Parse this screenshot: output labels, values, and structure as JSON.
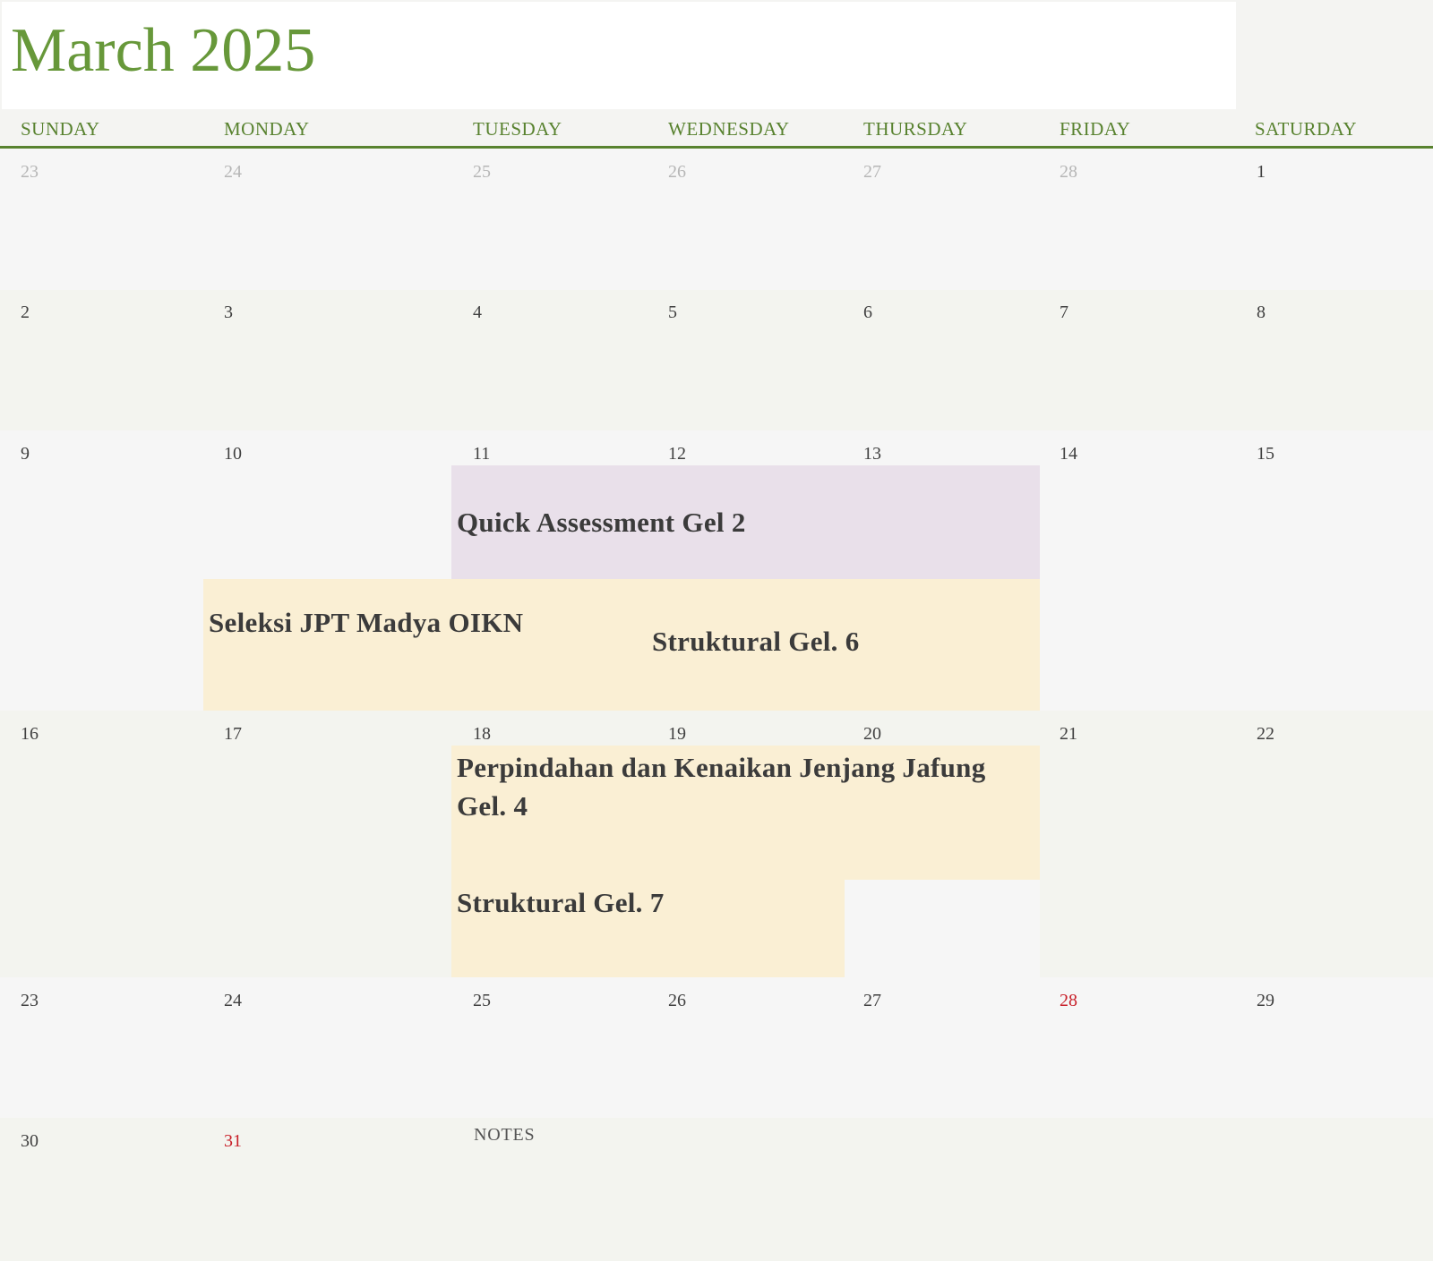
{
  "title": "March 2025",
  "day_names": [
    "SUNDAY",
    "MONDAY",
    "TUESDAY",
    "WEDNESDAY",
    "THURSDAY",
    "FRIDAY",
    "SATURDAY"
  ],
  "weeks": [
    [
      "23",
      "24",
      "25",
      "26",
      "27",
      "28",
      "1"
    ],
    [
      "2",
      "3",
      "4",
      "5",
      "6",
      "7",
      "8"
    ],
    [
      "9",
      "10",
      "11",
      "12",
      "13",
      "14",
      "15"
    ],
    [
      "16",
      "17",
      "18",
      "19",
      "20",
      "21",
      "22"
    ],
    [
      "23",
      "24",
      "25",
      "26",
      "27",
      "28",
      "29"
    ],
    [
      "30",
      "31"
    ]
  ],
  "events": {
    "quick_assessment": "Quick Assessment Gel 2",
    "seleksi_jpt": "Seleksi JPT Madya OIKN",
    "struktural_6": "Struktural Gel. 6",
    "perpindahan": "Perpindahan dan Kenaikan Jenjang Jafung Gel. 4",
    "struktural_7": "Struktural Gel. 7"
  },
  "notes_label": "NOTES",
  "colors": {
    "title": "#67983a",
    "header": "#58822f",
    "event_purple": "#e9e0ea",
    "event_yellow": "#faefd4",
    "holiday_red": "#c8202a"
  }
}
